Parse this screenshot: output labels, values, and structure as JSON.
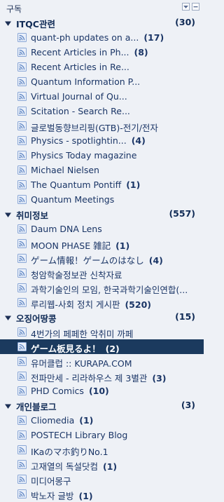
{
  "header": {
    "title": "구독"
  },
  "folders": [
    {
      "name": "ITQC관련",
      "count": "(30)",
      "feeds": [
        {
          "label": "quant-ph updates on a...",
          "count": "(17)"
        },
        {
          "label": "Recent Articles in Ph...",
          "count": "(8)"
        },
        {
          "label": "Recent Articles in Re...",
          "count": ""
        },
        {
          "label": "Quantum Information P...",
          "count": ""
        },
        {
          "label": "Virtual Journal of Qu...",
          "count": ""
        },
        {
          "label": "Scitation - Search Re...",
          "count": ""
        },
        {
          "label": "글로벌동향브리핑(GTB)-전기/전자",
          "count": ""
        },
        {
          "label": "Physics - spotlightin...",
          "count": "(4)"
        },
        {
          "label": "Physics Today magazine",
          "count": ""
        },
        {
          "label": "Michael Nielsen",
          "count": ""
        },
        {
          "label": "The Quantum Pontiff",
          "count": "(1)"
        },
        {
          "label": "Quantum Meetings",
          "count": ""
        }
      ]
    },
    {
      "name": "취미정보",
      "count": "(557)",
      "feeds": [
        {
          "label": "Daum DNA Lens",
          "count": ""
        },
        {
          "label": "MOON PHASE 雑記",
          "count": "(1)"
        },
        {
          "label": "ゲーム情報！ゲームのはなし",
          "count": "(4)"
        },
        {
          "label": "청암학술정보관 신착자료",
          "count": ""
        },
        {
          "label": "과학기술인의 모임, 한국과학기술인연합(...",
          "count": ""
        },
        {
          "label": "루리웹-사회 정치 게시판",
          "count": "(520)"
        }
      ]
    },
    {
      "name": "오징어땅콩",
      "count": "(15)",
      "feeds": [
        {
          "label": "4번가의 페페한 악취미 까페",
          "count": ""
        },
        {
          "label": "ゲーム板見るよ！",
          "count": "(2)",
          "selected": true
        },
        {
          "label": "유머클럽 :: KURAPA.COM",
          "count": ""
        },
        {
          "label": "전파만세 - 리라하우스 제 3별관",
          "count": "(3)"
        },
        {
          "label": "PHD Comics",
          "count": "(10)"
        }
      ]
    },
    {
      "name": "개인블로그",
      "count": "(3)",
      "feeds": [
        {
          "label": "Cliomedia",
          "count": "(1)"
        },
        {
          "label": "POSTECH Library Blog",
          "count": ""
        },
        {
          "label": "IKaのマホ釣りNo.1",
          "count": ""
        },
        {
          "label": "고재열의 독설닷컴",
          "count": "(1)"
        },
        {
          "label": "미디어몽구",
          "count": ""
        },
        {
          "label": "박노자 글방",
          "count": "(1)"
        }
      ]
    }
  ],
  "colors": {
    "selected_bg": "#1b3a5e",
    "rss_icon": "#8aa7d6"
  }
}
